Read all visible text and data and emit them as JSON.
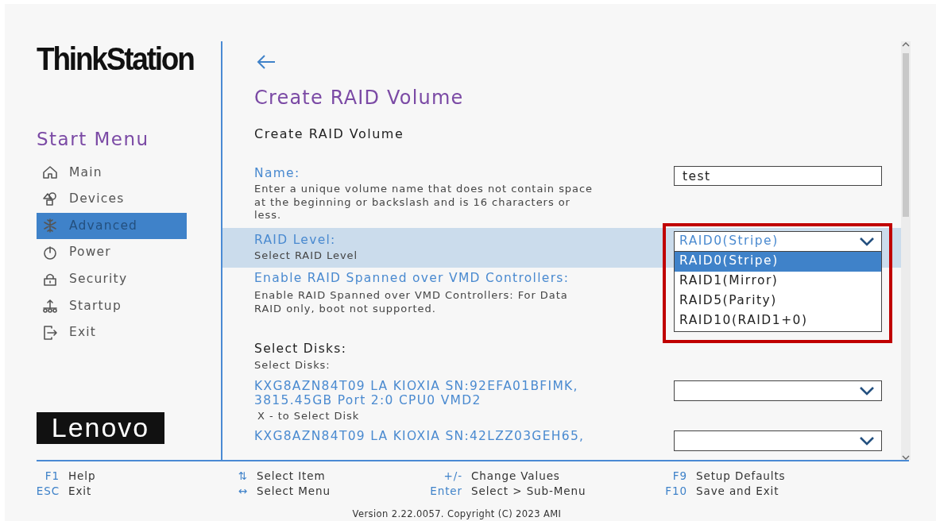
{
  "brand": {
    "product_logo": "ThinkStation",
    "vendor_logo": "Lenovo"
  },
  "sidebar": {
    "title": "Start Menu",
    "items": [
      {
        "label": "Main",
        "selected": false
      },
      {
        "label": "Devices",
        "selected": false
      },
      {
        "label": "Advanced",
        "selected": true
      },
      {
        "label": "Power",
        "selected": false
      },
      {
        "label": "Security",
        "selected": false
      },
      {
        "label": "Startup",
        "selected": false
      },
      {
        "label": "Exit",
        "selected": false
      }
    ]
  },
  "page": {
    "title": "Create RAID Volume",
    "subtitle": "Create RAID Volume"
  },
  "settings": [
    {
      "kind": "text",
      "label": "Name:",
      "help": "Enter a unique volume name that does not contain space at the beginning or backslash and is 16 characters or less.",
      "value": "test",
      "selected": false
    },
    {
      "kind": "select",
      "label": "RAID Level:",
      "help": "Select RAID Level",
      "value": "RAID0(Stripe)",
      "selected": true,
      "expanded": true,
      "highlighted": true,
      "options": [
        {
          "label": "RAID0(Stripe)",
          "selected": true
        },
        {
          "label": "RAID1(Mirror)",
          "selected": false
        },
        {
          "label": "RAID5(Parity)",
          "selected": false
        },
        {
          "label": "RAID10(RAID1+0)",
          "selected": false
        }
      ]
    },
    {
      "kind": "info",
      "label": "Enable RAID Spanned over VMD Controllers:",
      "help": "Enable RAID Spanned over VMD Controllers: For Data RAID only, boot not supported.",
      "selected": false
    },
    {
      "kind": "heading",
      "label": "Select Disks:",
      "help": "Select Disks:",
      "selected": false
    },
    {
      "kind": "disk",
      "label": "KXG8AZN84T09 LA KIOXIA SN:92EFA01BFIMK, 3815.45GB  Port 2:0 CPU0 VMD2",
      "help": "X - to Select Disk",
      "selected": false
    },
    {
      "kind": "disk",
      "label": "KXG8AZN84T09 LA KIOXIA SN:42LZZ03GEH65,",
      "selected": false
    }
  ],
  "footer": {
    "hints": [
      {
        "key": "F1",
        "label": "Help"
      },
      {
        "key": "⇅",
        "label": "Select Item"
      },
      {
        "key": "+/-",
        "label": "Change Values"
      },
      {
        "key": "F9",
        "label": "Setup Defaults"
      },
      {
        "key": "ESC",
        "label": "Exit"
      },
      {
        "key": "↔",
        "label": "Select Menu"
      },
      {
        "key": "Enter",
        "label": "Select > Sub-Menu"
      },
      {
        "key": "F10",
        "label": "Save and Exit"
      }
    ],
    "version": "Version 2.22.0057. Copyright (C) 2023 AMI"
  }
}
